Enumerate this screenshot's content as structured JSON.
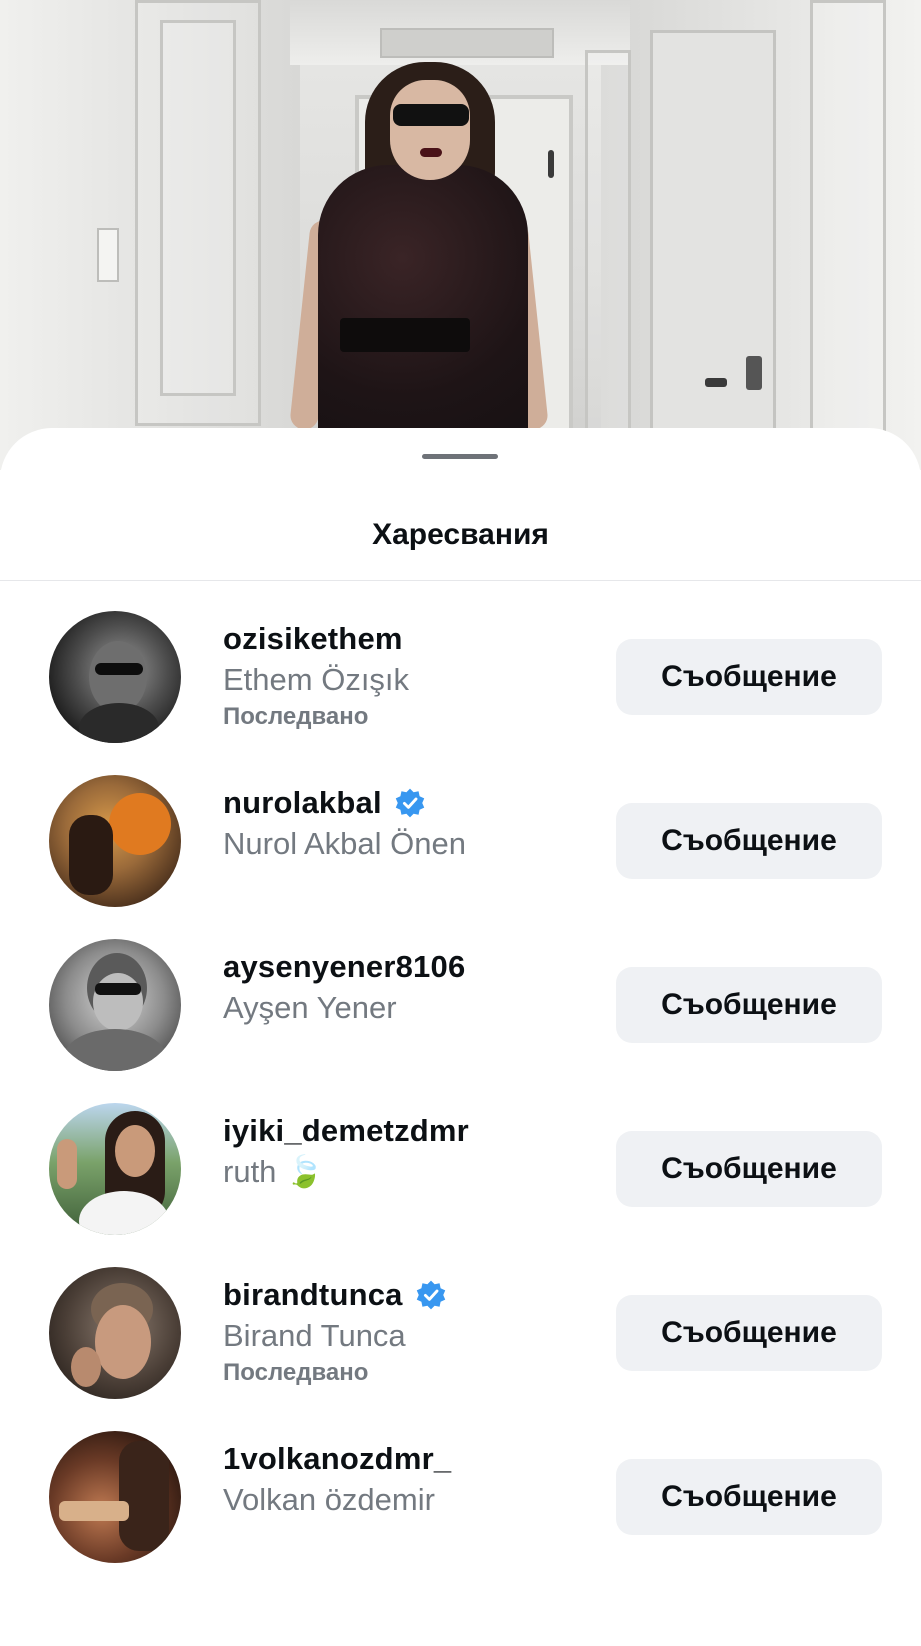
{
  "sheet": {
    "title": "Харесвания"
  },
  "likes": [
    {
      "username": "ozisikethem",
      "full_name": "Ethem Özışık",
      "verified": false,
      "status": "Последвано",
      "button": "Съобщение",
      "avatar_icon": "avatar-photo"
    },
    {
      "username": "nurolakbal",
      "full_name": "Nurol Akbal Önen",
      "verified": true,
      "status": "",
      "button": "Съобщение",
      "avatar_icon": "avatar-photo"
    },
    {
      "username": "aysenyener8106",
      "full_name": "Ayşen Yener",
      "verified": false,
      "status": "",
      "button": "Съобщение",
      "avatar_icon": "avatar-photo"
    },
    {
      "username": "iyiki_demetzdmr",
      "full_name": "ruth 🍃",
      "verified": false,
      "status": "",
      "button": "Съобщение",
      "avatar_icon": "avatar-photo"
    },
    {
      "username": "birandtunca",
      "full_name": "Birand Tunca",
      "verified": true,
      "status": "Последвано",
      "button": "Съобщение",
      "avatar_icon": "avatar-photo"
    },
    {
      "username": "1volkanozdmr_",
      "full_name": "Volkan özdemir",
      "verified": false,
      "status": "",
      "button": "Съобщение",
      "avatar_icon": "avatar-photo"
    }
  ],
  "colors": {
    "verified_badge": "#3897f0",
    "button_bg": "#eff1f4",
    "secondary_text": "#737980",
    "primary_text": "#0c1014"
  }
}
